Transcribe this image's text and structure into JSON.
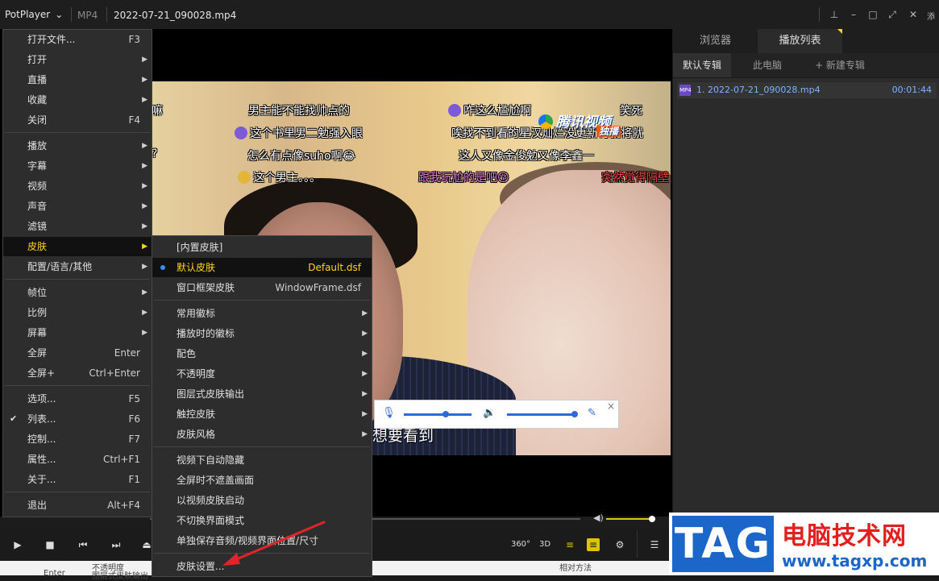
{
  "titlebar": {
    "app_name": "PotPlayer",
    "format": "MP4",
    "file_name": "2022-07-21_090028.mp4",
    "side_text": "添"
  },
  "video": {
    "danmu": [
      "男主能不能找帅点的",
      "咋这么尴尬啊",
      "笑死",
      "这个书里男二勉强入眼",
      "唉找不到看的星汉灿烂没更新将就将就",
      "怎么有点像suho啊😂",
      "这人又像金俊勉又像李鑫一",
      "这个男主。。。",
      "跟我玩尬的是吧😚",
      "突然觉得隔壁",
      "嘛",
      "?"
    ],
    "logo_text": "腾讯视频",
    "logo_badge": "独播",
    "subtitle": "想要看到"
  },
  "main_menu": {
    "items": [
      {
        "label": "打开文件...",
        "shortcut": "F3"
      },
      {
        "label": "打开"
      },
      {
        "label": "直播"
      },
      {
        "label": "收藏"
      },
      {
        "label": "关闭",
        "shortcut": "F4"
      },
      {
        "label": "播放"
      },
      {
        "label": "字幕"
      },
      {
        "label": "视频"
      },
      {
        "label": "声音"
      },
      {
        "label": "滤镜"
      },
      {
        "label": "皮肤"
      },
      {
        "label": "配置/语言/其他"
      },
      {
        "label": "帧位"
      },
      {
        "label": "比例"
      },
      {
        "label": "屏幕"
      },
      {
        "label": "全屏",
        "shortcut": "Enter"
      },
      {
        "label": "全屏+",
        "shortcut": "Ctrl+Enter"
      },
      {
        "label": "选项...",
        "shortcut": "F5"
      },
      {
        "label": "列表...",
        "shortcut": "F6"
      },
      {
        "label": "控制...",
        "shortcut": "F7"
      },
      {
        "label": "属性...",
        "shortcut": "Ctrl+F1"
      },
      {
        "label": "关于...",
        "shortcut": "F1"
      },
      {
        "label": "退出",
        "shortcut": "Alt+F4"
      }
    ]
  },
  "skin_menu": {
    "items": [
      {
        "label": "[内置皮肤]"
      },
      {
        "label": "默认皮肤",
        "value": "Default.dsf"
      },
      {
        "label": "窗口框架皮肤",
        "value": "WindowFrame.dsf"
      },
      {
        "label": "常用徽标"
      },
      {
        "label": "播放时的徽标"
      },
      {
        "label": "配色"
      },
      {
        "label": "不透明度"
      },
      {
        "label": "图层式皮肤输出"
      },
      {
        "label": "触控皮肤"
      },
      {
        "label": "皮肤风格"
      },
      {
        "label": "视频下自动隐藏"
      },
      {
        "label": "全屏时不遮盖画面"
      },
      {
        "label": "以视频皮肤启动"
      },
      {
        "label": "不切换界面模式"
      },
      {
        "label": "单独保存音频/视频界面位置/尺寸"
      },
      {
        "label": "皮肤设置..."
      }
    ]
  },
  "panel": {
    "tabs": [
      "浏览器",
      "播放列表"
    ],
    "subtabs": [
      "默认专辑",
      "此电脑",
      "+ 新建专辑"
    ],
    "playlist": [
      {
        "name": "1. 2022-07-21_090028.mp4",
        "duration": "00:01:44",
        "type": "MP4"
      }
    ]
  },
  "controls": {
    "label_360": "360°",
    "label_3d": "3D",
    "volume_level": 0.95
  },
  "bottom_strip": [
    "不透明度",
    "Enter",
    "图层式皮肤输出",
    "相对方法"
  ],
  "watermark": {
    "tag": "TAG",
    "cn": "电脑技术网",
    "url": "www.tagxp.com"
  },
  "colors": {
    "highlight": "#ffd323",
    "accent": "#3b8cff",
    "playlist_text": "#7cb4ff",
    "annotation": "#e0252a"
  }
}
